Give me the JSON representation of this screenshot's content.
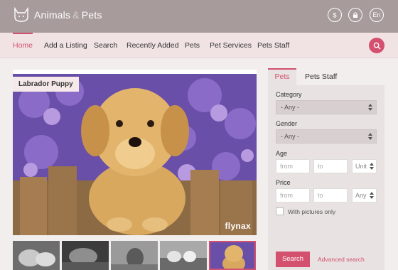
{
  "header": {
    "brand_left": "Animals",
    "brand_amp": "&",
    "brand_right": "Pets",
    "currency_icon": "dollar-icon",
    "account_icon": "lock-icon",
    "language": "En"
  },
  "nav": {
    "items": [
      {
        "label": "Home",
        "active": true
      },
      {
        "label": "Add a Listing"
      },
      {
        "label": "Search"
      },
      {
        "label": "Recently Added"
      },
      {
        "label": "Pets"
      },
      {
        "label": "Pet Services"
      },
      {
        "label": "Pets Staff"
      }
    ]
  },
  "featured": {
    "label": "Labrador Puppy",
    "watermark": "flynax"
  },
  "search_panel": {
    "tabs": [
      "Pets",
      "Pets Staff"
    ],
    "category_label": "Category",
    "category_value": "- Any -",
    "gender_label": "Gender",
    "gender_value": "- Any -",
    "age_label": "Age",
    "age_from": "from",
    "age_to": "to",
    "age_unit": "Unit",
    "price_label": "Price",
    "price_from": "from",
    "price_to": "to",
    "price_currency": "Any",
    "pictures_only": "With pictures only",
    "search_button": "Search",
    "advanced_link": "Advanced search"
  },
  "colors": {
    "accent": "#d4506f",
    "header_bg": "#a89b9b",
    "nav_bg": "#f1e3e3"
  }
}
